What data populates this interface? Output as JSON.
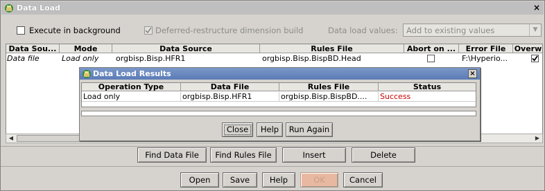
{
  "window": {
    "title": "Data Load",
    "close_glyph": "×"
  },
  "options": {
    "execute_background": {
      "label": "Execute in background",
      "checked": false
    },
    "deferred_restructure": {
      "label": "Deferred-restructure dimension build",
      "checked": true
    },
    "data_load_values": {
      "label": "Data load values:",
      "value": "Add to existing values"
    }
  },
  "grid": {
    "columns": [
      "Data Sou...",
      "Mode",
      "Data Source",
      "Rules File",
      "Abort on ...",
      "Error File",
      "Overw"
    ],
    "rows": [
      {
        "data_source_type": "Data file",
        "mode": "Load only",
        "data_source": "orgbisp.Bisp.HFR1",
        "rules_file": "orgbisp.Bisp.BispBD.Head",
        "abort_on_error": false,
        "error_file": "F:\\Hyperio...",
        "overwrite": true
      }
    ]
  },
  "buttons": {
    "find_data_file": "Find Data File",
    "find_rules_file": "Find Rules File",
    "insert": "Insert",
    "delete": "Delete",
    "open": "Open",
    "save": "Save",
    "help": "Help",
    "ok": "OK",
    "cancel": "Cancel"
  },
  "results_dialog": {
    "title": "Data Load Results",
    "close_glyph": "×",
    "columns": [
      "Operation Type",
      "Data File",
      "Rules File",
      "Status"
    ],
    "rows": [
      {
        "operation_type": "Load only",
        "data_file": "orgbisp.Bisp.HFR1",
        "rules_file": "orgbisp.Bisp.BispBD....",
        "status": "Success"
      }
    ],
    "buttons": {
      "close": "Close",
      "help": "Help",
      "run_again": "Run Again"
    }
  },
  "colors": {
    "success": "#cc0000",
    "dialog_title": "#6a88bf",
    "disabled_ok": "#e8b8a0"
  },
  "icons": {
    "window_icon": "data-load-icon",
    "dialog_icon": "data-load-results-icon"
  }
}
